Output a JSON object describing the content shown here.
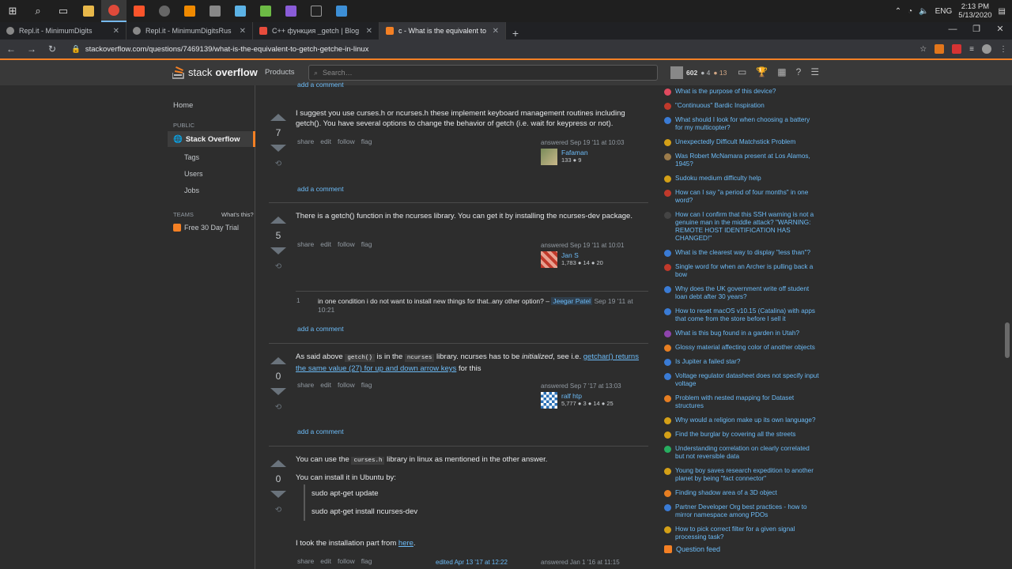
{
  "taskbar": {
    "icons": [
      "windows-icon",
      "search-icon",
      "task-view-icon",
      "explorer-icon",
      "chrome-icon",
      "brave-icon",
      "steam-icon",
      "vlc-icon",
      "calculator-icon",
      "paint-icon",
      "notepad-icon",
      "vscode-icon",
      "terminal-icon",
      "remote-icon"
    ],
    "lang": "ENG",
    "time": "2:13 PM",
    "date": "5/13/2020"
  },
  "tabs": [
    {
      "title": "Repl.it - MinimumDigits",
      "color": "#888888"
    },
    {
      "title": "Repl.it - MinimumDigitsRus",
      "color": "#888888"
    },
    {
      "title": "C++ функция _getch | Blog",
      "color": "#e74c3c"
    },
    {
      "title": "c - What is the equivalent to getc",
      "color": "#f48024"
    }
  ],
  "address": {
    "url": "stackoverflow.com/questions/7469139/what-is-the-equivalent-to-getch-getche-in-linux"
  },
  "header": {
    "logo_a": "stack",
    "logo_b": "overflow",
    "products": "Products",
    "search_placeholder": "Search…",
    "rep": "602",
    "silver": "● 4",
    "bronze": "● 13"
  },
  "nav": {
    "home": "Home",
    "public": "PUBLIC",
    "stackoverflow": "Stack Overflow",
    "tags": "Tags",
    "users": "Users",
    "jobs": "Jobs",
    "teams": "TEAMS",
    "whats": "What's this?",
    "trial": "Free 30 Day Trial"
  },
  "common": {
    "add_comment": "add a comment",
    "share": "share",
    "edit": "edit",
    "follow": "follow",
    "flag": "flag"
  },
  "answers": [
    {
      "votes": "7",
      "text": "I suggest you use curses.h or ncurses.h these implement keyboard management routines including getch(). You have several options to change the behavior of getch (i.e. wait for keypress or not).",
      "answered": "answered Sep 19 '11 at 10:03",
      "user": "Fafaman",
      "rep": "133 ● 9"
    },
    {
      "votes": "5",
      "text": "There is a getch() function in the ncurses library. You can get it by installing the ncurses-dev package.",
      "answered": "answered Sep 19 '11 at 10:01",
      "user": "Jan S",
      "rep": "1,783 ● 14 ● 20",
      "comment": {
        "score": "1",
        "text": "in one condition i do not want to install new things for that..any other option? – ",
        "user": "Jeegar Patel",
        "date": " Sep 19 '11 at 10:21"
      }
    },
    {
      "votes": "0",
      "text_a": "As said above ",
      "code_a": "getch()",
      "text_b": " is in the ",
      "code_b": "ncurses",
      "text_c": " library. ncurses has to be ",
      "em": "initialized",
      "text_d": ", see i.e. ",
      "link": "getchar() returns the same value (27) for up and down arrow keys",
      "text_e": " for this",
      "answered": "answered Sep 7 '17 at 13:03",
      "user": "ralf htp",
      "rep": "5,777 ● 3 ● 14 ● 25"
    },
    {
      "votes": "0",
      "line1_a": "You can use the ",
      "line1_code": "curses.h",
      "line1_b": " library in linux as mentioned in the other answer.",
      "line2": "You can install it in Ubuntu by:",
      "cmd1": "sudo apt-get update",
      "cmd2": "sudo apt-get install ncurses-dev",
      "line3_a": "I took the installation part from ",
      "line3_link": "here",
      "line3_b": ".",
      "edited": "edited Apr 13 '17 at 12:22",
      "answered": "answered Jan 1 '16 at 11:15"
    }
  ],
  "hot": [
    {
      "t": "What is the purpose of this device?",
      "c": "#e04a5f"
    },
    {
      "t": "\"Continuous\" Bardic Inspiration",
      "c": "#c0392b"
    },
    {
      "t": "What should I look for when choosing a battery for my multicopter?",
      "c": "#3a7bd5"
    },
    {
      "t": "Unexpectedly Difficult Matchstick Problem",
      "c": "#d4a017"
    },
    {
      "t": "Was Robert McNamara present at Los Alamos, 1945?",
      "c": "#9b7b4b"
    },
    {
      "t": "Sudoku medium difficulty help",
      "c": "#d4a017"
    },
    {
      "t": "How can I say \"a period of four months\" in one word?",
      "c": "#c0392b"
    },
    {
      "t": "How can I confirm that this SSH warning is not a genuine man in the middle attack? \"WARNING: REMOTE HOST IDENTIFICATION HAS CHANGED!\"",
      "c": "#444444"
    },
    {
      "t": "What is the clearest way to display \"less than\"?",
      "c": "#3a7bd5"
    },
    {
      "t": "Single word for when an Archer is pulling back a bow",
      "c": "#c0392b"
    },
    {
      "t": "Why does the UK government write off student loan debt after 30 years?",
      "c": "#3a7bd5"
    },
    {
      "t": "How to reset macOS v10.15 (Catalina) with apps that come from the store before I sell it",
      "c": "#3a7bd5"
    },
    {
      "t": "What is this bug found in a garden in Utah?",
      "c": "#8e44ad"
    },
    {
      "t": "Glossy material affecting color of another objects",
      "c": "#e67e22"
    },
    {
      "t": "Is Jupiter a failed star?",
      "c": "#3a7bd5"
    },
    {
      "t": "Voltage regulator datasheet does not specify input voltage",
      "c": "#3a7bd5"
    },
    {
      "t": "Problem with nested mapping for Dataset structures",
      "c": "#e67e22"
    },
    {
      "t": "Why would a religion make up its own language?",
      "c": "#d4a017"
    },
    {
      "t": "Find the burglar by covering all the streets",
      "c": "#d4a017"
    },
    {
      "t": "Understanding correlation on clearly correlated but not reversible data",
      "c": "#27ae60"
    },
    {
      "t": "Young boy saves research expedition to another planet by being \"fact connector\"",
      "c": "#d4a017"
    },
    {
      "t": "Finding shadow area of a 3D object",
      "c": "#e67e22"
    },
    {
      "t": "Partner Developer Org best practices - how to mirror namespace among PDOs",
      "c": "#3a7bd5"
    },
    {
      "t": "How to pick correct filter for a given signal processing task?",
      "c": "#d4a017"
    }
  ],
  "feed": "Question feed"
}
